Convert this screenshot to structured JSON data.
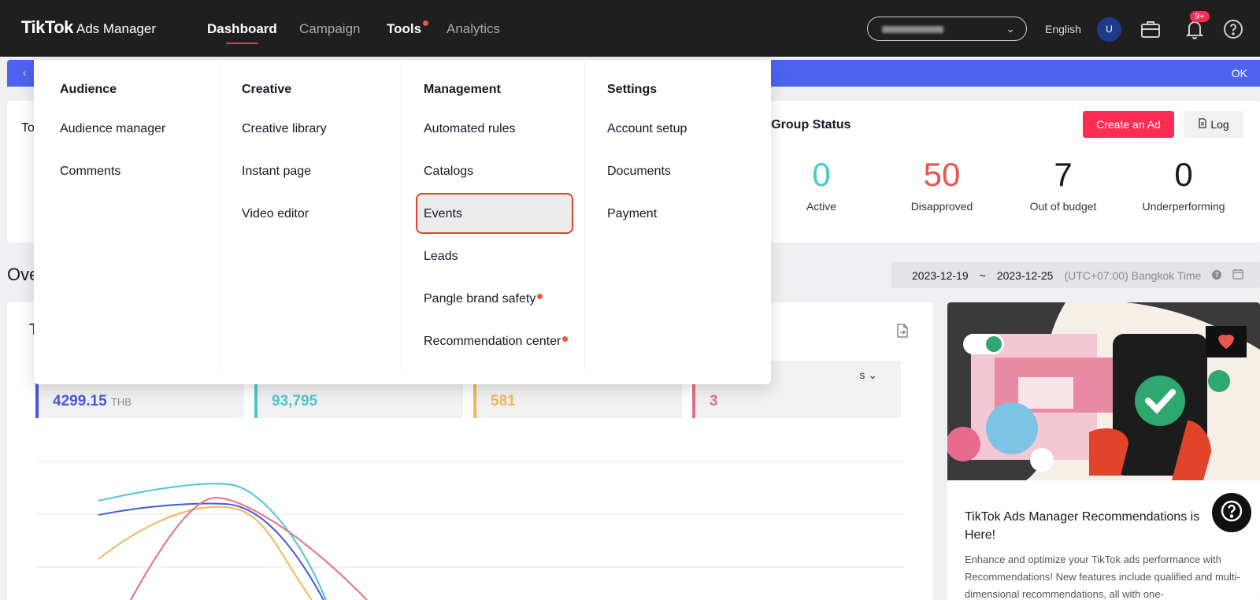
{
  "brand": {
    "name": "TikTok",
    "product": "Ads Manager"
  },
  "nav": {
    "dashboard": "Dashboard",
    "campaign": "Campaign",
    "tools": "Tools",
    "analytics": "Analytics"
  },
  "header": {
    "language": "English",
    "avatar_initial": "U",
    "notification_badge": "9+"
  },
  "banner": {
    "ok_label": "OK"
  },
  "summary": {
    "left_label_partial": "To",
    "group_status_title": "d Group Status",
    "create_ad_label": "Create an Ad",
    "log_label": "Log",
    "stats": [
      {
        "value": "0",
        "label": "Active",
        "color": "#4fc6cf"
      },
      {
        "value": "50",
        "label": "Disapproved",
        "color": "#e9574c"
      },
      {
        "value": "7",
        "label": "Out of budget",
        "color": "#222222"
      },
      {
        "value": "0",
        "label": "Underperforming",
        "color": "#222222"
      }
    ]
  },
  "overview": {
    "title_partial": "Ove",
    "date_start": "2023-12-19",
    "date_sep": "~",
    "date_end": "2023-12-25",
    "timezone": "(UTC+07:00) Bangkok Time"
  },
  "metrics": [
    {
      "value": "4299.15",
      "unit": "THB",
      "color": "#4858e0",
      "caption": ""
    },
    {
      "value": "93,795",
      "unit": "",
      "color": "#4fc6cf",
      "caption": ""
    },
    {
      "value": "581",
      "unit": "",
      "color": "#f2b65c",
      "caption": ""
    },
    {
      "value": "3",
      "unit": "",
      "color": "#e56e86",
      "caption": "s"
    }
  ],
  "chart_title_partial": "T",
  "recommendation": {
    "title": "TikTok Ads Manager Recommendations is Here!",
    "description": "Enhance and optimize your TikTok ads performance with Recommendations! New features include qualified and multi-dimensional recommendations, all with one-"
  },
  "tools_menu": {
    "audience": {
      "heading": "Audience",
      "items": [
        "Audience manager",
        "Comments"
      ]
    },
    "creative": {
      "heading": "Creative",
      "items": [
        "Creative library",
        "Instant page",
        "Video editor"
      ]
    },
    "management": {
      "heading": "Management",
      "items": [
        "Automated rules",
        "Catalogs",
        "Events",
        "Leads",
        "Pangle brand safety",
        "Recommendation center"
      ]
    },
    "settings": {
      "heading": "Settings",
      "items": [
        "Account setup",
        "Documents",
        "Payment"
      ]
    }
  },
  "colors": {
    "accent": "#fe2c55",
    "banner": "#4b63f0",
    "nav_bg": "#1f1f1f",
    "highlight_border": "#e2432b"
  }
}
